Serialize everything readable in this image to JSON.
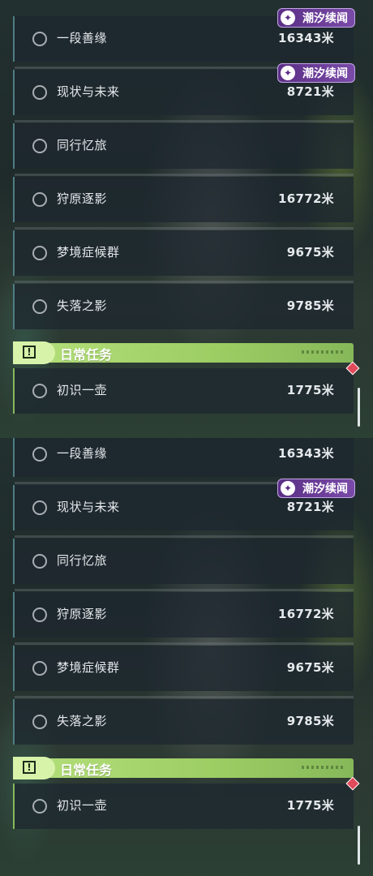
{
  "badge_label": "潮汐续闻",
  "badge_icon": "tide-news-icon",
  "section_title": "日常任务",
  "section_icon": "alert-box-icon",
  "accent_colors": {
    "section_green": "#9ccd63",
    "badge_purple": "#6b3c98",
    "alert_red": "#e04a5a"
  },
  "panels": [
    {
      "quests": [
        {
          "name": "一段善缘",
          "distance": "16343米"
        },
        {
          "name": "现状与未来",
          "distance": "8721米"
        },
        {
          "name": "同行忆旅",
          "distance": ""
        },
        {
          "name": "狩原逐影",
          "distance": "16772米"
        },
        {
          "name": "梦境症候群",
          "distance": "9675米"
        },
        {
          "name": "失落之影",
          "distance": "9785米"
        }
      ],
      "daily": [
        {
          "name": "初识一壶",
          "distance": "1775米"
        }
      ]
    },
    {
      "quests": [
        {
          "name": "一段善缘",
          "distance": "16343米"
        },
        {
          "name": "现状与未来",
          "distance": "8721米"
        },
        {
          "name": "同行忆旅",
          "distance": ""
        },
        {
          "name": "狩原逐影",
          "distance": "16772米"
        },
        {
          "name": "梦境症候群",
          "distance": "9675米"
        },
        {
          "name": "失落之影",
          "distance": "9785米"
        }
      ],
      "daily": [
        {
          "name": "初识一壶",
          "distance": "1775米"
        }
      ]
    }
  ]
}
